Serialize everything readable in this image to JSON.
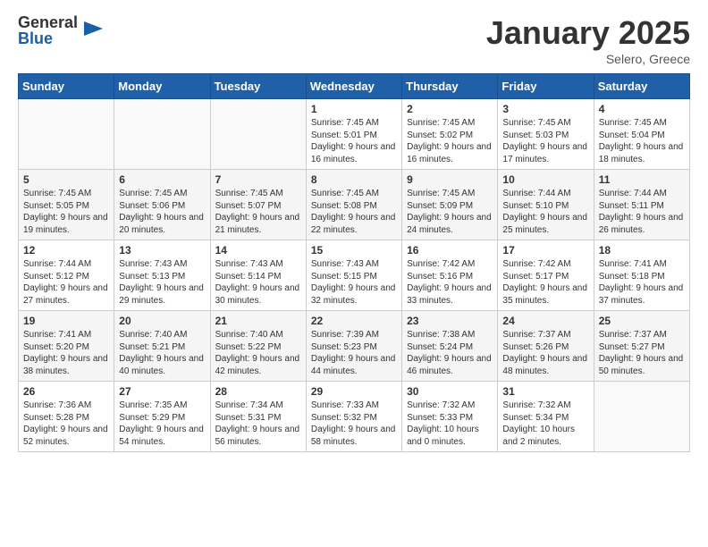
{
  "logo": {
    "general": "General",
    "blue": "Blue"
  },
  "header": {
    "month": "January 2025",
    "location": "Selero, Greece"
  },
  "weekdays": [
    "Sunday",
    "Monday",
    "Tuesday",
    "Wednesday",
    "Thursday",
    "Friday",
    "Saturday"
  ],
  "weeks": [
    [
      {
        "day": "",
        "content": ""
      },
      {
        "day": "",
        "content": ""
      },
      {
        "day": "",
        "content": ""
      },
      {
        "day": "1",
        "content": "Sunrise: 7:45 AM\nSunset: 5:01 PM\nDaylight: 9 hours and 16 minutes."
      },
      {
        "day": "2",
        "content": "Sunrise: 7:45 AM\nSunset: 5:02 PM\nDaylight: 9 hours and 16 minutes."
      },
      {
        "day": "3",
        "content": "Sunrise: 7:45 AM\nSunset: 5:03 PM\nDaylight: 9 hours and 17 minutes."
      },
      {
        "day": "4",
        "content": "Sunrise: 7:45 AM\nSunset: 5:04 PM\nDaylight: 9 hours and 18 minutes."
      }
    ],
    [
      {
        "day": "5",
        "content": "Sunrise: 7:45 AM\nSunset: 5:05 PM\nDaylight: 9 hours and 19 minutes."
      },
      {
        "day": "6",
        "content": "Sunrise: 7:45 AM\nSunset: 5:06 PM\nDaylight: 9 hours and 20 minutes."
      },
      {
        "day": "7",
        "content": "Sunrise: 7:45 AM\nSunset: 5:07 PM\nDaylight: 9 hours and 21 minutes."
      },
      {
        "day": "8",
        "content": "Sunrise: 7:45 AM\nSunset: 5:08 PM\nDaylight: 9 hours and 22 minutes."
      },
      {
        "day": "9",
        "content": "Sunrise: 7:45 AM\nSunset: 5:09 PM\nDaylight: 9 hours and 24 minutes."
      },
      {
        "day": "10",
        "content": "Sunrise: 7:44 AM\nSunset: 5:10 PM\nDaylight: 9 hours and 25 minutes."
      },
      {
        "day": "11",
        "content": "Sunrise: 7:44 AM\nSunset: 5:11 PM\nDaylight: 9 hours and 26 minutes."
      }
    ],
    [
      {
        "day": "12",
        "content": "Sunrise: 7:44 AM\nSunset: 5:12 PM\nDaylight: 9 hours and 27 minutes."
      },
      {
        "day": "13",
        "content": "Sunrise: 7:43 AM\nSunset: 5:13 PM\nDaylight: 9 hours and 29 minutes."
      },
      {
        "day": "14",
        "content": "Sunrise: 7:43 AM\nSunset: 5:14 PM\nDaylight: 9 hours and 30 minutes."
      },
      {
        "day": "15",
        "content": "Sunrise: 7:43 AM\nSunset: 5:15 PM\nDaylight: 9 hours and 32 minutes."
      },
      {
        "day": "16",
        "content": "Sunrise: 7:42 AM\nSunset: 5:16 PM\nDaylight: 9 hours and 33 minutes."
      },
      {
        "day": "17",
        "content": "Sunrise: 7:42 AM\nSunset: 5:17 PM\nDaylight: 9 hours and 35 minutes."
      },
      {
        "day": "18",
        "content": "Sunrise: 7:41 AM\nSunset: 5:18 PM\nDaylight: 9 hours and 37 minutes."
      }
    ],
    [
      {
        "day": "19",
        "content": "Sunrise: 7:41 AM\nSunset: 5:20 PM\nDaylight: 9 hours and 38 minutes."
      },
      {
        "day": "20",
        "content": "Sunrise: 7:40 AM\nSunset: 5:21 PM\nDaylight: 9 hours and 40 minutes."
      },
      {
        "day": "21",
        "content": "Sunrise: 7:40 AM\nSunset: 5:22 PM\nDaylight: 9 hours and 42 minutes."
      },
      {
        "day": "22",
        "content": "Sunrise: 7:39 AM\nSunset: 5:23 PM\nDaylight: 9 hours and 44 minutes."
      },
      {
        "day": "23",
        "content": "Sunrise: 7:38 AM\nSunset: 5:24 PM\nDaylight: 9 hours and 46 minutes."
      },
      {
        "day": "24",
        "content": "Sunrise: 7:37 AM\nSunset: 5:26 PM\nDaylight: 9 hours and 48 minutes."
      },
      {
        "day": "25",
        "content": "Sunrise: 7:37 AM\nSunset: 5:27 PM\nDaylight: 9 hours and 50 minutes."
      }
    ],
    [
      {
        "day": "26",
        "content": "Sunrise: 7:36 AM\nSunset: 5:28 PM\nDaylight: 9 hours and 52 minutes."
      },
      {
        "day": "27",
        "content": "Sunrise: 7:35 AM\nSunset: 5:29 PM\nDaylight: 9 hours and 54 minutes."
      },
      {
        "day": "28",
        "content": "Sunrise: 7:34 AM\nSunset: 5:31 PM\nDaylight: 9 hours and 56 minutes."
      },
      {
        "day": "29",
        "content": "Sunrise: 7:33 AM\nSunset: 5:32 PM\nDaylight: 9 hours and 58 minutes."
      },
      {
        "day": "30",
        "content": "Sunrise: 7:32 AM\nSunset: 5:33 PM\nDaylight: 10 hours and 0 minutes."
      },
      {
        "day": "31",
        "content": "Sunrise: 7:32 AM\nSunset: 5:34 PM\nDaylight: 10 hours and 2 minutes."
      },
      {
        "day": "",
        "content": ""
      }
    ]
  ]
}
